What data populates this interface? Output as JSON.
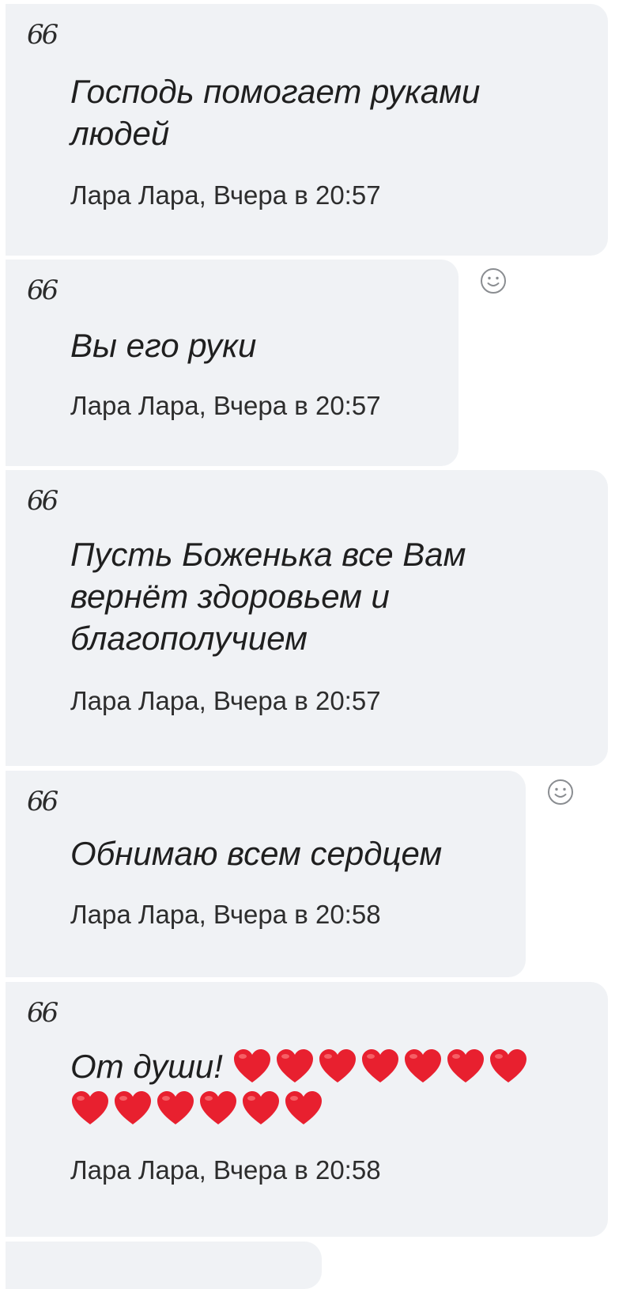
{
  "messages": [
    {
      "quote_mark": "66",
      "text": "Господь помогает руками людей",
      "meta": "Лара Лара, Вчера в 20:57"
    },
    {
      "quote_mark": "66",
      "text": "Вы его руки",
      "meta": "Лара Лара, Вчера в 20:57",
      "has_reaction_button": true
    },
    {
      "quote_mark": "66",
      "text": "Пусть Боженька все Вам вернёт здоровьем и благополучием",
      "meta": "Лара Лара, Вчера в 20:57"
    },
    {
      "quote_mark": "66",
      "text": "Обнимаю всем сердцем",
      "meta": "Лара Лара, Вчера в 20:58",
      "has_reaction_button": true
    },
    {
      "quote_mark": "66",
      "text": "От души!",
      "emoji": "heart-emoji",
      "emoji_count": 13,
      "meta": "Лара Лара, Вчера в 20:58"
    }
  ],
  "colors": {
    "bubble": "#f0f2f5",
    "text": "#1f1f1f",
    "heart": "#e8202f",
    "icon": "#8a8d91"
  },
  "icons": {
    "reaction": "smiley-face-icon"
  }
}
